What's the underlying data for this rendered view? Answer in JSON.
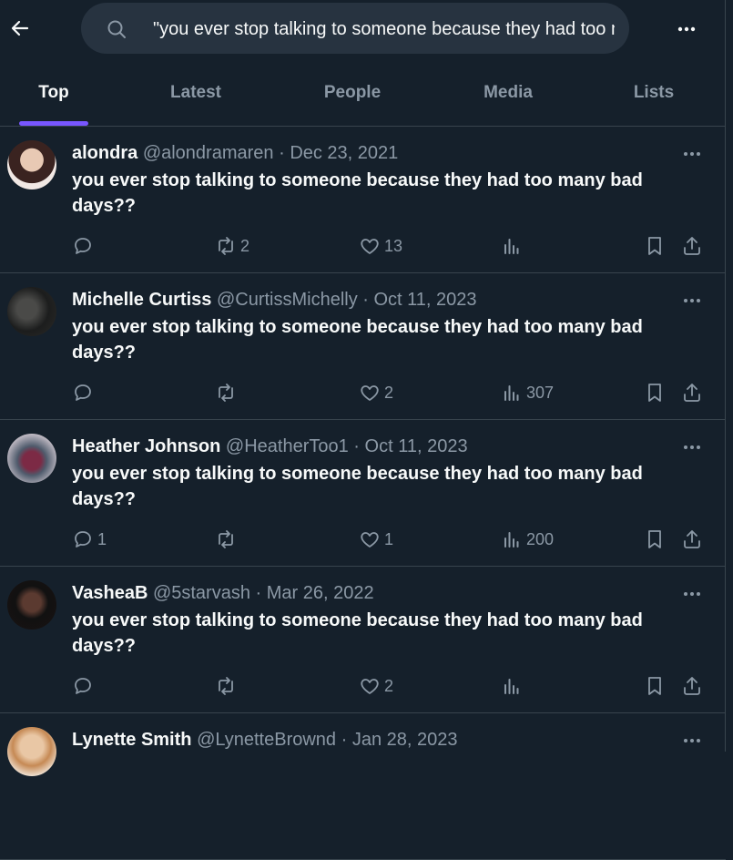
{
  "search": {
    "query": "\"you ever stop talking to someone because they had too many bad days??\""
  },
  "tabs": [
    {
      "label": "Top",
      "active": true
    },
    {
      "label": "Latest",
      "active": false
    },
    {
      "label": "People",
      "active": false
    },
    {
      "label": "Media",
      "active": false
    },
    {
      "label": "Lists",
      "active": false
    }
  ],
  "colors": {
    "background": "#15202b",
    "accent": "#7856ff",
    "muted": "#8b98a5",
    "divider": "#38444d"
  },
  "tweets": [
    {
      "name": "alondra",
      "handle": "@alondramaren",
      "date": "Dec 23, 2021",
      "text": "you ever stop talking to someone because they had too many bad days??",
      "replies": "",
      "retweets": "2",
      "likes": "13",
      "views": ""
    },
    {
      "name": "Michelle Curtiss",
      "handle": "@CurtissMichelly",
      "date": "Oct 11, 2023",
      "text": "you ever stop talking to someone because they had too many bad days??",
      "replies": "",
      "retweets": "",
      "likes": "2",
      "views": "307"
    },
    {
      "name": "Heather Johnson",
      "handle": "@HeatherToo1",
      "date": "Oct 11, 2023",
      "text": "you ever stop talking to someone because they had too many bad days??",
      "replies": "1",
      "retweets": "",
      "likes": "1",
      "views": "200"
    },
    {
      "name": "VasheaB",
      "handle": "@5starvash",
      "date": "Mar 26, 2022",
      "text": "you ever stop talking to someone because they had too many bad days??",
      "replies": "",
      "retweets": "",
      "likes": "2",
      "views": ""
    },
    {
      "name": "Lynette Smith",
      "handle": "@LynetteBrownd",
      "date": "Jan 28, 2023",
      "text": "",
      "replies": "",
      "retweets": "",
      "likes": "",
      "views": ""
    }
  ],
  "icons": {
    "back": "arrow-left-icon",
    "search": "search-icon",
    "more": "more-horizontal-icon",
    "reply": "reply-icon",
    "retweet": "retweet-icon",
    "like": "heart-icon",
    "views": "views-icon",
    "bookmark": "bookmark-icon",
    "share": "share-icon"
  }
}
